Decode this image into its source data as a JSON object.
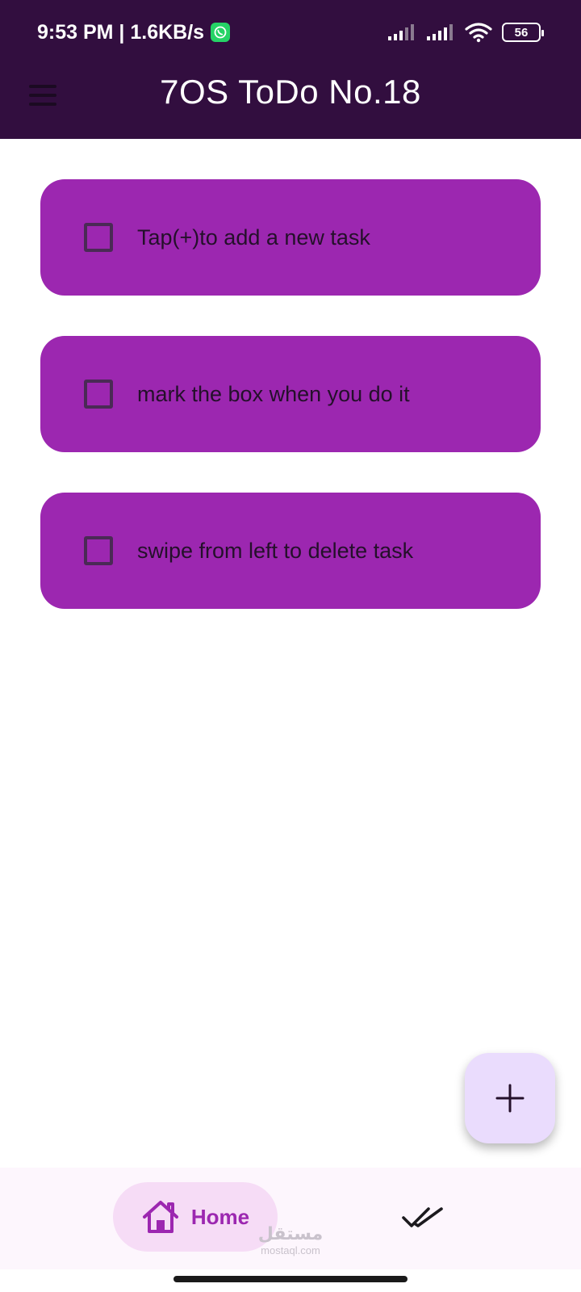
{
  "status_bar": {
    "time_speed": "9:53 PM | 1.6KB/s",
    "battery": "56"
  },
  "app_bar": {
    "title": "7OS ToDo No.18"
  },
  "tasks": [
    {
      "text": "Tap(+)to add a new task",
      "checked": false
    },
    {
      "text": "mark the box when you do it",
      "checked": false
    },
    {
      "text": "swipe from left to delete task",
      "checked": false
    }
  ],
  "fab": {
    "icon": "plus-icon"
  },
  "bottom_nav": {
    "home_label": "Home",
    "home_icon": "home-icon",
    "done_icon": "double-check-icon"
  },
  "watermark": {
    "arabic": "مستقل",
    "latin": "mostaql.com"
  },
  "colors": {
    "appbar_bg": "#320e3f",
    "task_bg": "#9c27b0",
    "fab_bg": "#eadcfd",
    "nav_bg": "#fdf6fd",
    "nav_active_bg": "#f6dcf6",
    "accent": "#9c27b0"
  }
}
